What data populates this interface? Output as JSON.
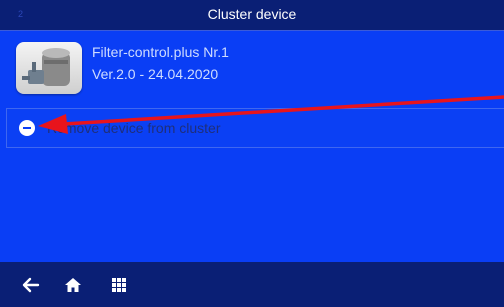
{
  "header": {
    "number": "2",
    "title": "Cluster device"
  },
  "device": {
    "icon": "filter-pump-icon",
    "name": "Filter-control.plus Nr.1",
    "version": "Ver.2.0 - 24.04.2020"
  },
  "actions": {
    "remove_label": "Remove device from cluster",
    "remove_icon": "minus-circle-icon"
  },
  "annotation": {
    "arrow_color": "#e8141c"
  },
  "footer": {
    "back_icon": "back-arrow-icon",
    "home_icon": "home-icon",
    "menu_icon": "grid-menu-icon"
  },
  "colors": {
    "background": "#0a3ef5",
    "bar": "#0a1f75",
    "text": "#ffffff"
  }
}
